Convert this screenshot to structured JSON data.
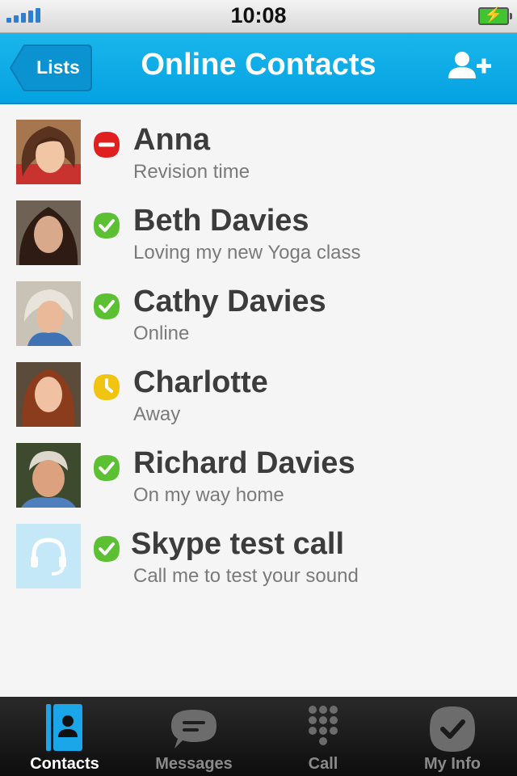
{
  "status_bar": {
    "time": "10:08"
  },
  "nav": {
    "back_label": "Lists",
    "title": "Online Contacts",
    "add_icon": "add-contact-icon"
  },
  "colors": {
    "accent": "#0aa6e6",
    "online": "#5cc132",
    "busy": "#e01f1f",
    "away": "#f2c412"
  },
  "contacts": [
    {
      "name": "Anna",
      "mood": "Revision time",
      "status": "busy"
    },
    {
      "name": "Beth Davies",
      "mood": "Loving my new Yoga class",
      "status": "online"
    },
    {
      "name": "Cathy Davies",
      "mood": "Online",
      "status": "online"
    },
    {
      "name": "Charlotte",
      "mood": "Away",
      "status": "away"
    },
    {
      "name": "Richard Davies",
      "mood": "On my way home",
      "status": "online"
    },
    {
      "name": "Skype test call",
      "mood": "Call me to test your sound",
      "status": "online"
    }
  ],
  "tabs": [
    {
      "label": "Contacts",
      "icon": "contacts-icon",
      "active": true
    },
    {
      "label": "Messages",
      "icon": "messages-icon",
      "active": false
    },
    {
      "label": "Call",
      "icon": "dialpad-icon",
      "active": false
    },
    {
      "label": "My Info",
      "icon": "my-info-icon",
      "active": false
    }
  ]
}
